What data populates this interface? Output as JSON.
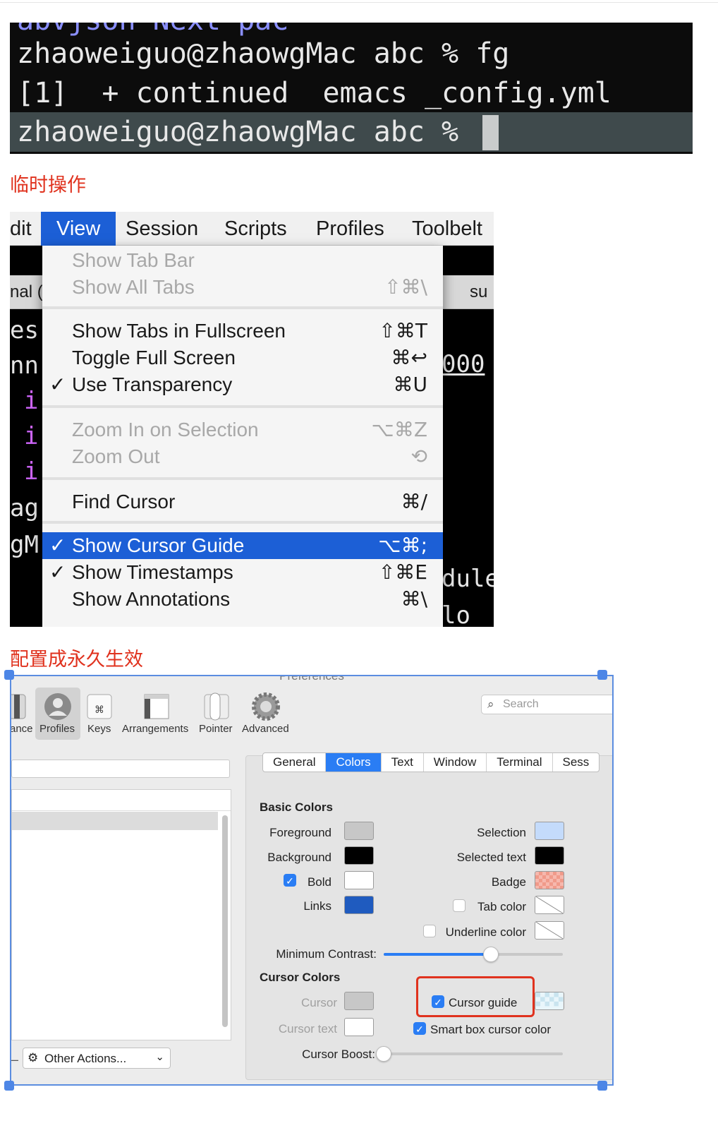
{
  "terminal": {
    "top_cut": "abvjson       Next          pac",
    "line1": "zhaoweiguo@zhaowgMac abc % fg",
    "line2": "[1]  + continued  emacs _config.yml",
    "line3": "zhaoweiguo@zhaowgMac abc % "
  },
  "captions": {
    "temporary": "临时操作",
    "permanent": "配置成永久生效"
  },
  "menubar": {
    "items": [
      "dit",
      "View",
      "Session",
      "Scripts",
      "Profiles",
      "Toolbelt"
    ],
    "tab_left": "nal (",
    "tab_right": "su"
  },
  "background_terminal": {
    "lines": [
      "es",
      "nn",
      "i",
      "i",
      "i",
      "ag",
      "gM"
    ],
    "right_frag1": "000",
    "right_frag2": "dule",
    "right_frag3": "lo"
  },
  "view_menu": {
    "items": [
      {
        "label": "Show Tab Bar",
        "shortcut": "",
        "checked": "",
        "state": "disabled"
      },
      {
        "label": "Show All Tabs",
        "shortcut": "⇧⌘\\",
        "checked": "",
        "state": "disabled"
      },
      {
        "label": "Show Tabs in Fullscreen",
        "shortcut": "⇧⌘T",
        "checked": "",
        "state": "enabled"
      },
      {
        "label": "Toggle Full Screen",
        "shortcut": "⌘↩",
        "checked": "",
        "state": "enabled"
      },
      {
        "label": "Use Transparency",
        "shortcut": "⌘U",
        "checked": "✓",
        "state": "enabled"
      },
      {
        "label": "Zoom In on Selection",
        "shortcut": "⌥⌘Z",
        "checked": "",
        "state": "disabled"
      },
      {
        "label": "Zoom Out",
        "shortcut": "⟲",
        "checked": "",
        "state": "disabled"
      },
      {
        "label": "Find Cursor",
        "shortcut": "⌘/",
        "checked": "",
        "state": "enabled"
      },
      {
        "label": "Show Cursor Guide",
        "shortcut": "⌥⌘;",
        "checked": "✓",
        "state": "selected"
      },
      {
        "label": "Show Timestamps",
        "shortcut": "⇧⌘E",
        "checked": "✓",
        "state": "enabled"
      },
      {
        "label": "Show Annotations",
        "shortcut": "⌘\\",
        "checked": "",
        "state": "enabled"
      }
    ]
  },
  "prefs": {
    "window_title": "Preferences",
    "toolbar": [
      {
        "label": "ance",
        "icon": "appearance-icon"
      },
      {
        "label": "Profiles",
        "icon": "profiles-icon"
      },
      {
        "label": "Keys",
        "icon": "keys-icon"
      },
      {
        "label": "Arrangements",
        "icon": "arrangements-icon"
      },
      {
        "label": "Pointer",
        "icon": "pointer-icon"
      },
      {
        "label": "Advanced",
        "icon": "advanced-icon"
      }
    ],
    "search_placeholder": "Search",
    "other_actions": "Other Actions...",
    "tabs": [
      "General",
      "Colors",
      "Text",
      "Window",
      "Terminal",
      "Sess"
    ],
    "active_tab": "Colors",
    "basic_colors_heading": "Basic Colors",
    "labels": {
      "foreground": "Foreground",
      "background": "Background",
      "bold": "Bold",
      "links": "Links",
      "selection": "Selection",
      "selected_text": "Selected text",
      "badge": "Badge",
      "tab_color": "Tab color",
      "underline_color": "Underline color",
      "minimum_contrast": "Minimum Contrast:",
      "cursor_colors_heading": "Cursor Colors",
      "cursor": "Cursor",
      "cursor_text": "Cursor text",
      "cursor_guide": "Cursor guide",
      "smart_box": "Smart box cursor color",
      "cursor_boost": "Cursor Boost:"
    },
    "checkboxes": {
      "bold": true,
      "tab_color": false,
      "underline_color": false,
      "cursor_guide": true,
      "smart_box": true
    },
    "colors": {
      "foreground": "#c7c7c7",
      "background": "#000000",
      "bold": "#ffffff",
      "links": "#1f5bbf",
      "selection": "#c4dbfb",
      "selected_text": "#000000",
      "badge": "#f09a8a",
      "cursor": "#c7c7c7",
      "cursor_text": "#ffffff",
      "accent": "#2a7df4",
      "highlight_box": "#e0321e"
    },
    "minimum_contrast_value": 0.6,
    "cursor_boost_value": 0.0
  }
}
